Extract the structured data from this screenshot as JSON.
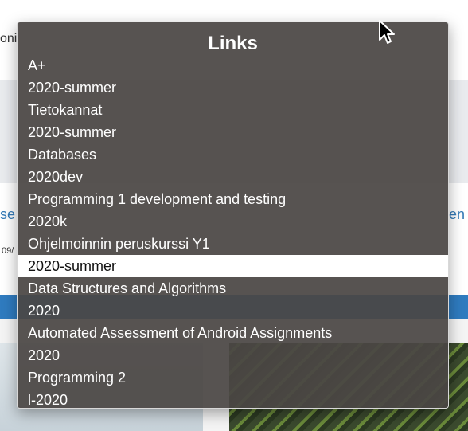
{
  "background": {
    "left_fragment": "oni",
    "link_left": "se",
    "link_right": "en",
    "date_fragment": "09/"
  },
  "popup": {
    "title": "Links",
    "items": [
      "A+",
      "2020-summer",
      "Tietokannat",
      "2020-summer",
      "Databases",
      "2020dev",
      "Programming 1 development and testing",
      "2020k",
      "Ohjelmoinnin peruskurssi Y1",
      "2020-summer",
      "Data Structures and Algorithms",
      "2020",
      "Automated Assessment of Android Assignments",
      "2020",
      "Programming 2",
      "l-2020"
    ],
    "selected_index": 9
  },
  "colors": {
    "popup_bg": "#4a4644",
    "selected_bg": "#ffffff",
    "link_blue": "#337ab7"
  },
  "icons": {
    "cursor": "mouse-pointer-icon"
  }
}
